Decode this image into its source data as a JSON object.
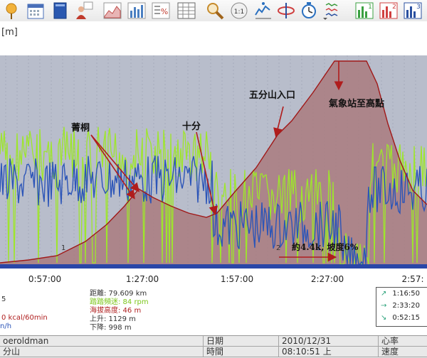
{
  "toolbar": {
    "buttons": [
      {
        "name": "pin-icon",
        "color": "#e89a1c"
      },
      {
        "name": "calendar-icon",
        "color": "#4a6fb8"
      },
      {
        "name": "book-icon",
        "color": "#2a58b0"
      },
      {
        "name": "athlete-icon",
        "color": "#c0392b"
      },
      {
        "name": "area-graph-icon",
        "color": "#c0504d"
      },
      {
        "name": "bar-graph-icon",
        "color": "#4a7fc1"
      },
      {
        "name": "percent-icon",
        "color": "#777777"
      },
      {
        "name": "table-icon",
        "color": "#666666"
      },
      {
        "name": "zoom-icon",
        "color": "#c68a2a"
      },
      {
        "name": "scale-one-to-one-icon",
        "color": "#888888"
      },
      {
        "name": "stats-icon",
        "color": "#2a70c0"
      },
      {
        "name": "rotate-icon",
        "color": "#d04040"
      },
      {
        "name": "timer-icon",
        "color": "#2a70c0"
      },
      {
        "name": "series-select-icon",
        "color": "#3a9a3a"
      },
      {
        "name": "graph-1-icon",
        "color": "#3aa040"
      },
      {
        "name": "graph-2-icon",
        "color": "#d04040"
      },
      {
        "name": "graph-3-icon",
        "color": "#2a50a0"
      },
      {
        "name": "graph-4-icon",
        "color": "#2a50a0"
      }
    ],
    "graph_numbers": [
      "1",
      "2",
      "3",
      "4"
    ],
    "scale_label": "1:1"
  },
  "axis": {
    "left_unit": "[m]",
    "x_ticks": [
      "0:57:00",
      "1:27:00",
      "1:57:00",
      "2:27:00",
      "2:57:"
    ]
  },
  "annotations": {
    "jingtong": "菁桐",
    "shifen": "十分",
    "wufenshan": "五分山入口",
    "weather_station": "氣象站至高點",
    "slope": "約4.4k, 坡度6%",
    "lap1": "1",
    "lap2": "2"
  },
  "stats_left": {
    "line1": "5",
    "line2": "0 kcal/60min",
    "line3": "n/h"
  },
  "stats_mid": {
    "distance": "距離: 79.609 km",
    "cadence": "踏踏頻迷: 84 rpm",
    "altitude": "海拔高度: 46 m",
    "ascent": "上升: 1129 m",
    "descent": "下降: 998 m"
  },
  "stats_right": {
    "row1": "1:16:50",
    "row2": "2:33:20",
    "row3": "0:52:15"
  },
  "table": {
    "row1": [
      "oeroldman",
      "日期",
      "2010/12/31",
      "心率"
    ],
    "row2": [
      "分山",
      "時間",
      "08:10:51 上",
      "速度"
    ]
  },
  "colors": {
    "plot_bg": "#b8bdcb",
    "altitude_fill": "#a97b7f",
    "altitude_line": "#a01818",
    "cadence": "#9ee62b",
    "heartrate": "#2c55b8",
    "arrow": "#b01c1c",
    "axis_bar": "#2a47a8",
    "cadence_text": "#7cc61c",
    "altitude_text": "#b02020",
    "heartrate_text": "#2c55b8"
  }
}
